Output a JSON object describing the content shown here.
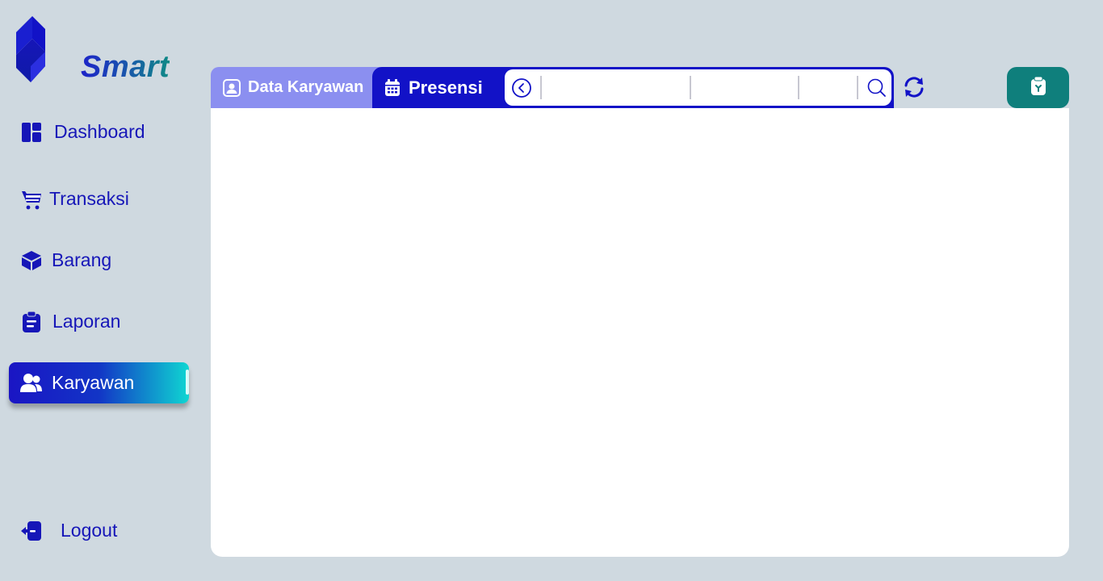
{
  "app": {
    "logo_text": "Smart",
    "logo_icon": "hexagon-bolt-logo"
  },
  "sidebar": {
    "items": [
      {
        "label": "Dashboard",
        "icon": "dashboard-icon"
      },
      {
        "label": "Transaksi",
        "icon": "cart-icon"
      },
      {
        "label": "Barang",
        "icon": "box-icon"
      },
      {
        "label": "Laporan",
        "icon": "clipboard-icon"
      },
      {
        "label": "Karyawan",
        "icon": "users-icon",
        "active": true
      }
    ],
    "logout_label": "Logout"
  },
  "tabs": {
    "data_karyawan": "Data Karyawan",
    "presensi": "Presensi"
  },
  "search": {
    "field_1": "",
    "field_2": "",
    "field_3": "",
    "field_4": ""
  },
  "colors": {
    "background": "#cfd9e0",
    "primary": "#1212c7",
    "tab_inactive": "#8b8ff0",
    "accent_teal": "#0f7f7c",
    "active_gradient_end": "#0fd6d2"
  }
}
